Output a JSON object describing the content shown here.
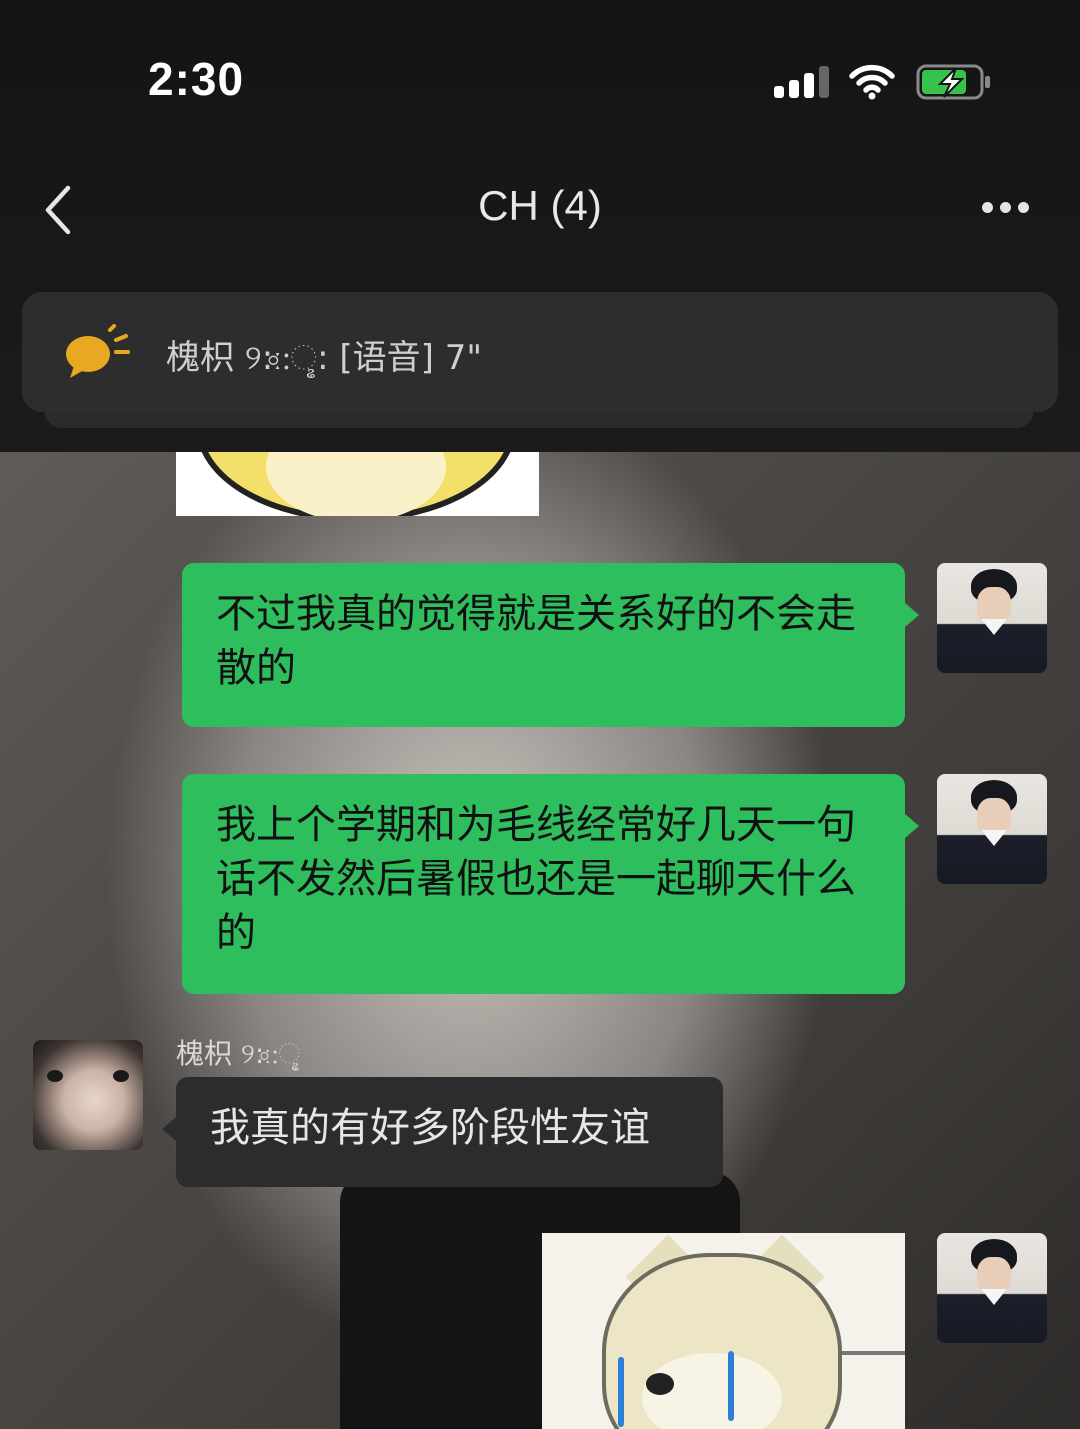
{
  "status_bar": {
    "time": "2:30"
  },
  "nav": {
    "title": "CH (4)"
  },
  "pinned_voice": {
    "text": "槐枳 ୨:ː⃘:ୢ: [语音] 7\""
  },
  "messages": [
    {
      "side": "right",
      "text": "不过我真的觉得就是关系好的不会走散的"
    },
    {
      "side": "right",
      "text": "我上个学期和为毛线经常好几天一句话不发然后暑假也还是一起聊天什么的"
    },
    {
      "side": "left",
      "sender": "槐枳 ୨:ː⃘:ୢ",
      "text": "我真的有好多阶段性友谊"
    }
  ],
  "colors": {
    "bubble_me": "#2fbe5e",
    "bubble_other": "#2c2c2c",
    "voice_icon": "#e8a820"
  }
}
